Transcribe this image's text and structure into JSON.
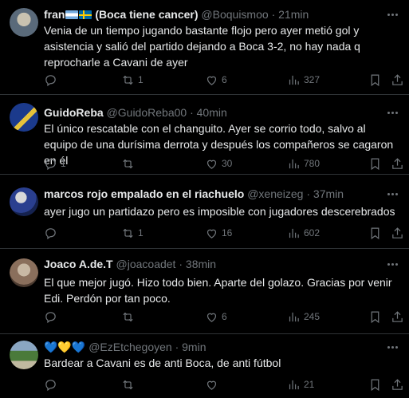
{
  "tweets": [
    {
      "name": "fran",
      "name_suffix": " (Boca tiene cancer)",
      "handle": "@Boquismoo",
      "sep": "·",
      "time": "21min",
      "text": "Venia de un tiempo jugando bastante flojo pero ayer metió gol y asistencia y salió del partido dejando a Boca 3-2, no hay nada q reprocharle a Cavani de ayer",
      "reply_count": "",
      "retweet_count": "1",
      "like_count": "6",
      "view_count": "327",
      "avatar_colors": [
        "#5a6a7a",
        "#c9c2b0"
      ]
    },
    {
      "name": "GuidoReba",
      "handle": "@GuidoReba00",
      "sep": "·",
      "time": "40min",
      "text": "El único rescatable con el changuito. Ayer se corrio todo, salvo al equipo de una durísima derrota y después los compañeros se cagaron en él",
      "reply_count": "1",
      "retweet_count": "",
      "like_count": "30",
      "view_count": "780",
      "avatar_colors": [
        "#1b3a8c",
        "#e6c23a"
      ]
    },
    {
      "name": "marcos rojo empalado en el riachuelo",
      "handle": "@xeneizeg",
      "sep": "·",
      "time": "37min",
      "text": "ayer jugo un partidazo pero es imposible con jugadores descerebrados",
      "reply_count": "",
      "retweet_count": "1",
      "like_count": "16",
      "view_count": "602",
      "avatar_colors": [
        "#2a3f8f",
        "#d9d9d9"
      ]
    },
    {
      "name": "Joaco A.de.T",
      "handle": "@joacoadet",
      "sep": "·",
      "time": "38min",
      "text": "El que mejor jugó. Hizo todo bien. Aparte del golazo. Gracias por venir Edi. Perdón por tan poco.",
      "reply_count": "",
      "retweet_count": "",
      "like_count": "6",
      "view_count": "245",
      "avatar_colors": [
        "#8a6f5c",
        "#c8b8a4"
      ]
    },
    {
      "name": "💙💛💙",
      "handle": "@EzEtchegoyen",
      "sep": "·",
      "time": "9min",
      "text": "Bardear a Cavani es de anti Boca, de anti fútbol",
      "reply_count": "",
      "retweet_count": "",
      "like_count": "",
      "view_count": "21",
      "avatar_colors": [
        "#4a7a3a",
        "#c0b9a0"
      ]
    }
  ],
  "icons": {
    "reply": "reply-icon",
    "retweet": "retweet-icon",
    "like": "like-icon",
    "views": "views-icon",
    "bookmark": "bookmark-icon",
    "share": "share-icon",
    "more": "more-icon"
  },
  "colors": {
    "background": "#000000",
    "text": "#e7e9ea",
    "muted": "#71767b",
    "divider": "#2f3336"
  }
}
